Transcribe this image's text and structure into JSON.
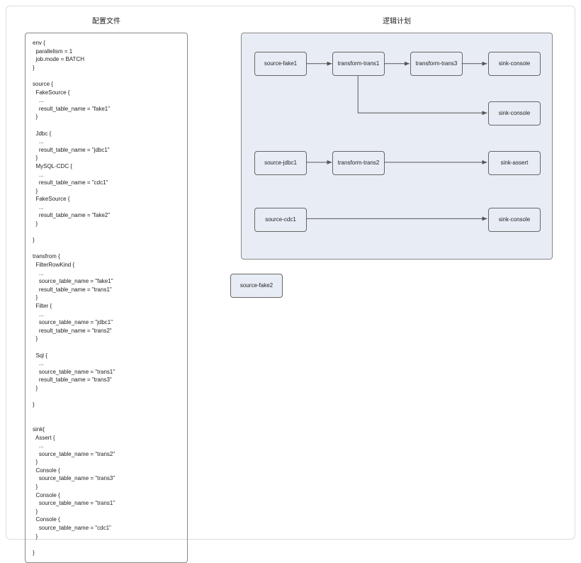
{
  "titles": {
    "left": "配置文件",
    "right": "逻辑计划"
  },
  "config_text": "env {\n  parallelism = 1\n  job.mode = BATCH\n}\n\nsource {\n  FakeSource {\n    ...\n    result_table_name = \"fake1\"\n  }\n\n  Jdbc {\n    ...\n    result_table_name = \"jdbc1\"\n  }\n  MySQL-CDC {\n    ...\n    result_table_name = \"cdc1\"\n  }\n  FakeSource {\n    ...\n    result_table_name = \"fake2\"\n  }\n\n}\n\ntransfrom {\n  FilterRowKind {\n    ...\n    source_table_name = \"fake1\"\n    result_table_name = \"trans1\"\n  }\n  Filter {\n    ...\n    source_table_name = \"jdbc1\"\n    result_table_name = \"trans2\"\n  }\n\n  Sql {\n    ...\n    source_table_name = \"trans1\"\n    result_table_name = \"trans3\"\n  }\n\n}\n\n\nsink{\n  Assert {\n    ...\n    source_table_name = \"trans2\"\n  }\n  Console {\n    source_table_name = \"trans3\"\n  }\n  Console {\n    source_table_name = \"trans1\"\n  }\n  Console {\n    source_table_name = \"cdc1\"\n  }\n\n}",
  "plan": {
    "nodes": {
      "source_fake1": "source-fake1",
      "transform_trans1": "transform-trans1",
      "transform_trans3": "transform-trans3",
      "sink_console_1": "sink-console",
      "sink_console_2": "sink-console",
      "source_jdbc1": "source-jdbc1",
      "transform_trans2": "transform-trans2",
      "sink_assert": "sink-assert",
      "source_cdc1": "source-cdc1",
      "sink_console_3": "sink-console"
    },
    "isolated_node": "source-fake2",
    "edges": [
      [
        "source_fake1",
        "transform_trans1"
      ],
      [
        "transform_trans1",
        "transform_trans3"
      ],
      [
        "transform_trans3",
        "sink_console_1"
      ],
      [
        "transform_trans1",
        "sink_console_2"
      ],
      [
        "source_jdbc1",
        "transform_trans2"
      ],
      [
        "transform_trans2",
        "sink_assert"
      ],
      [
        "source_cdc1",
        "sink_console_3"
      ]
    ]
  }
}
